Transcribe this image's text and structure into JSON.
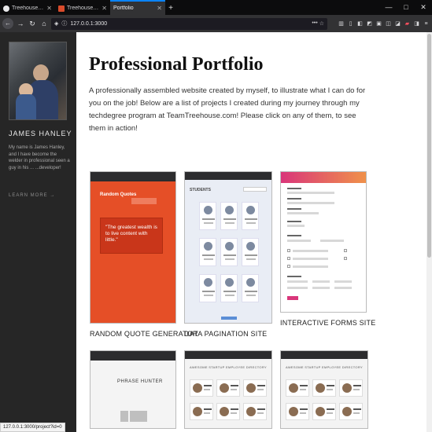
{
  "browser": {
    "tabs": [
      {
        "title": "Treehouse Techdegree Graduate",
        "active": false
      },
      {
        "title": "Treehouse Full Stack JavaScript",
        "active": false
      },
      {
        "title": "Portfolio",
        "active": true
      }
    ],
    "new_tab_label": "+",
    "window_controls": [
      "—",
      "□",
      "✕"
    ],
    "url": "127.0.0.1:3000",
    "accent": "#0a84ff"
  },
  "sidebar": {
    "name": "JAMES HANLEY",
    "bio": "My name is James Hanley, and I have become the welder in professional seen a guy in his ... ...developer!",
    "link": "LEARN MORE  →"
  },
  "main": {
    "title": "Professional Portfolio",
    "intro": "A professionally assembled website created by myself, to illustrate what I can do for you on the job! Below are a list of projects I created during my journey through my techdegree program at TeamTreehouse.com! Please click on any of them, to see them in action!"
  },
  "projects": [
    {
      "caption": "RANDOM QUOTE GENERATOR",
      "preview_heading": "Random Quotes",
      "preview_quote": "\"The greatest wealth is to live content with little.\"",
      "color": "#e54f27"
    },
    {
      "caption": "DATA PAGINATION SITE",
      "preview_heading": "STUDENTS",
      "color": "#e9edf5"
    },
    {
      "caption": "INTERACTIVE FORMS SITE",
      "color": "#d9367a"
    },
    {
      "caption": "",
      "preview_heading": "PHRASE HUNTER",
      "color": "#f4f4f4"
    },
    {
      "caption": "",
      "preview_heading": "AWESOME STARTUP EMPLOYEE DIRECTORY",
      "color": "#f3f3f3"
    },
    {
      "caption": "",
      "preview_heading": "AWESOME STARTUP EMPLOYEE DIRECTORY",
      "color": "#f3f3f3"
    }
  ],
  "status_bar": "127.0.0.1:3000/project?id=0"
}
